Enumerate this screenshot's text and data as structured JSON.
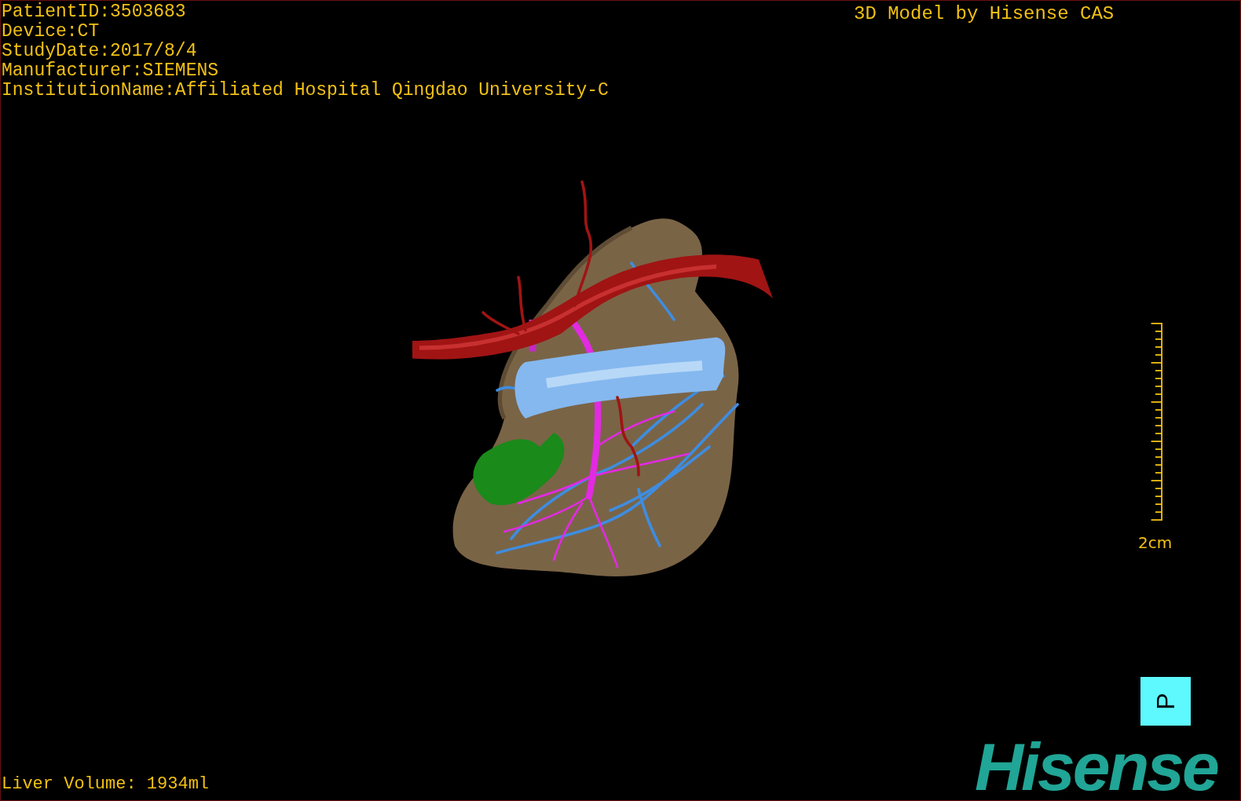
{
  "patient_info": [
    "PatientID:3503683",
    "Device:CT",
    "StudyDate:2017/8/4",
    "Manufacturer:SIEMENS",
    "InstitutionName:Affiliated Hospital Qingdao University-C"
  ],
  "model_title": "3D Model by Hisense CAS",
  "scale_bar": {
    "label": "2cm"
  },
  "orientation_cube": {
    "label": "P"
  },
  "logo": "Hisense",
  "liver_volume": "Liver Volume: 1934ml"
}
